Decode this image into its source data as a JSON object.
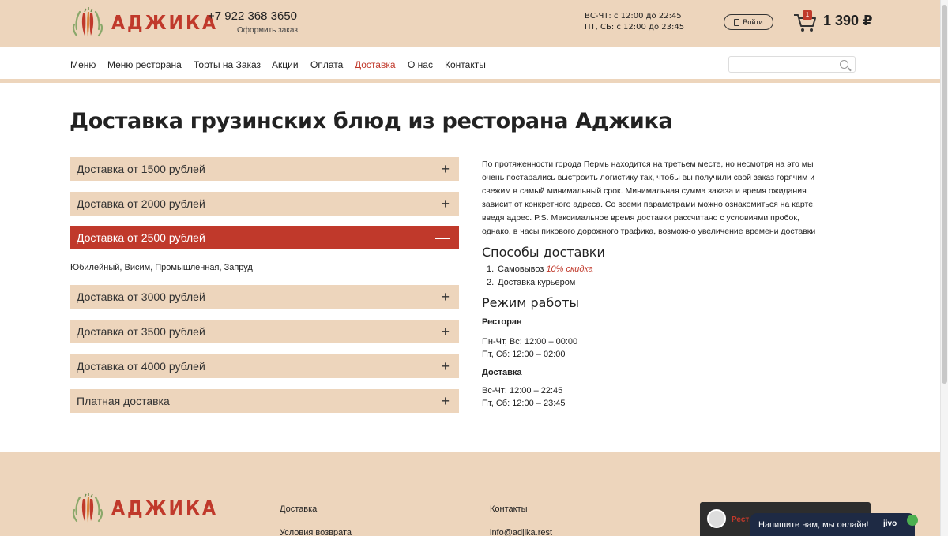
{
  "header": {
    "logo_text": "АДЖИКА",
    "phone": "+7 922 368 3650",
    "order_link": "Оформить заказ",
    "hours_line1": "ВС-ЧТ: с 12:00 до 22:45",
    "hours_line2": "ПТ, СБ: с 12:00 до 23:45",
    "login_label": "Войти",
    "cart_count": "1",
    "cart_total": "1 390 ₽"
  },
  "nav": {
    "items": [
      {
        "label": "Меню"
      },
      {
        "label": "Меню ресторана"
      },
      {
        "label": "Торты на Заказ"
      },
      {
        "label": "Акции"
      },
      {
        "label": "Оплата"
      },
      {
        "label": "Доставка",
        "active": true
      },
      {
        "label": "О нас"
      },
      {
        "label": "Контакты"
      }
    ],
    "search_placeholder": ""
  },
  "main": {
    "title": "Доставка грузинских блюд из ресторана Аджика",
    "accordion": [
      {
        "label": "Доставка от 1500 рублей",
        "sign": "+"
      },
      {
        "label": "Доставка от 2000 рублей",
        "sign": "+"
      },
      {
        "label": "Доставка от 2500 рублей",
        "sign": "—",
        "open": true,
        "body": "Юбилейный, Висим, Промышленная, Запруд"
      },
      {
        "label": "Доставка от 3000 рублей",
        "sign": "+"
      },
      {
        "label": "Доставка от 3500 рублей",
        "sign": "+"
      },
      {
        "label": "Доставка от 4000 рублей",
        "sign": "+"
      },
      {
        "label": "Платная доставка",
        "sign": "+"
      }
    ],
    "description": [
      "По протяженности города Пермь находится на третьем месте, но несмотря на это мы",
      "очень постарались выстроить логистику так, чтобы вы получили свой заказ горячим и",
      "свежим в самый минимальный срок. Минимальная сумма заказа и время ожидания",
      "зависит от конкретного адреса. Со всеми параметрами можно ознакомиться на карте,",
      "введя адрес. P.S. Максимальное время доставки рассчитано с условиями пробок,",
      "однако, в часы пикового дорожного трафика, возможно увеличение времени доставки"
    ],
    "methods_title": "Способы доставки",
    "methods": [
      {
        "num": "1.",
        "label": "Самовывоз",
        "extra": "10% скидка"
      },
      {
        "num": "2.",
        "label": "Доставка курьером",
        "extra": ""
      }
    ],
    "schedule_title": "Режим работы",
    "restaurant_title": "Ресторан",
    "restaurant_hours": [
      "Пн-Чт, Вс: 12:00 – 00:00",
      "Пт, Сб: 12:00 – 02:00"
    ],
    "delivery_title": "Доставка",
    "delivery_hours": [
      "Вс-Чт: 12:00 – 22:45",
      "Пт, Сб: 12:00 – 23:45"
    ]
  },
  "footer": {
    "logo_text": "АДЖИКА",
    "link_delivery": "Доставка",
    "link_returns": "Условия возврата",
    "link_contacts": "Контакты",
    "email": "info@adjika.rest",
    "chat_panel_text": "Рест"
  },
  "chat": {
    "label": "Напишите нам, мы онлайн!",
    "brand": "jivo"
  },
  "colors": {
    "beige": "#edd5bc",
    "accent_red": "#c0392b"
  }
}
